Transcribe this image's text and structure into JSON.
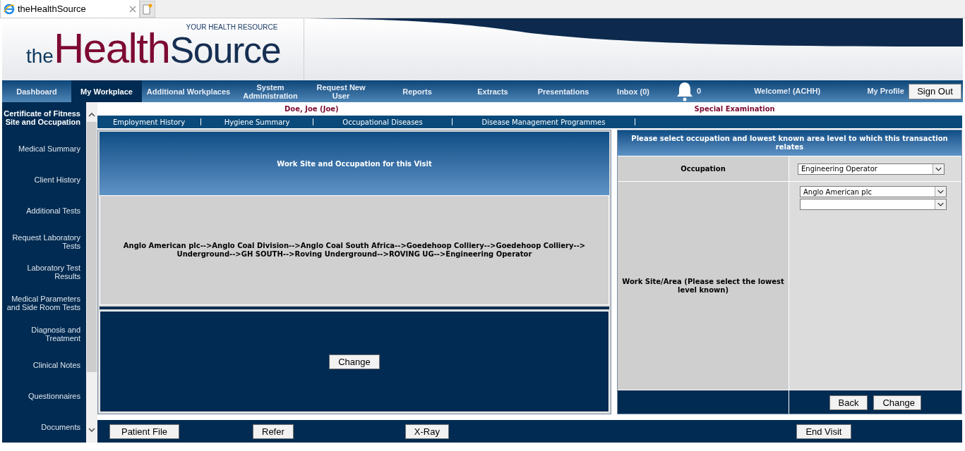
{
  "browser_tab": {
    "title": "theHealthSource"
  },
  "logo": {
    "the": "the",
    "health": "Health",
    "source": "Source",
    "tagline": "YOUR HEALTH RESOURCE"
  },
  "nav": {
    "items": [
      {
        "label": "Dashboard",
        "selected": false
      },
      {
        "label": "My Workplace",
        "selected": true
      },
      {
        "label": "Additional Workplaces",
        "selected": false
      },
      {
        "label": "System Administration",
        "selected": false
      },
      {
        "label": "Request New User",
        "selected": false
      },
      {
        "label": "Reports",
        "selected": false
      },
      {
        "label": "Extracts",
        "selected": false
      },
      {
        "label": "Presentations",
        "selected": false
      },
      {
        "label": "Inbox (0)",
        "selected": false
      }
    ],
    "notification_count": "0",
    "welcome": "Welcome! (ACHH)",
    "profile": "My Profile",
    "sign_out": "Sign Out"
  },
  "sidebar": {
    "items": [
      {
        "label": "Certificate of Fitness Site and Occupation",
        "selected": true
      },
      {
        "label": "Medical Summary",
        "selected": false
      },
      {
        "label": "Client History",
        "selected": false
      },
      {
        "label": "Additional Tests",
        "selected": false
      },
      {
        "label": "Request Laboratory Tests",
        "selected": false
      },
      {
        "label": "Laboratory Test Results",
        "selected": false
      },
      {
        "label": "Medical Parameters and Side Room Tests",
        "selected": false
      },
      {
        "label": "Diagnosis and Treatment",
        "selected": false
      },
      {
        "label": "Clinical Notes",
        "selected": false
      },
      {
        "label": "Questionnaires",
        "selected": false
      },
      {
        "label": "Documents",
        "selected": false
      }
    ]
  },
  "patient": {
    "name": "Doe, Joe (Joe)",
    "examination": "Special Examination"
  },
  "subtabs": [
    "Employment History",
    "Hygiene Summary",
    "Occupational Diseases",
    "Disease Management Programmes"
  ],
  "work_site": {
    "title": "Work Site and Occupation for this Visit",
    "path": "Anglo American plc-->Anglo Coal Division-->Anglo Coal South Africa-->Goedehoop Colliery-->Goedehoop Colliery-->Underground-->GH SOUTH-->Roving Underground-->ROVING UG-->Engineering Operator",
    "change_button": "Change"
  },
  "selection": {
    "title": "Please select occupation and lowest known area level to which this transaction relates",
    "occupation_label": "Occupation",
    "occupation_value": "Engineering Operator",
    "area_label": "Work Site/Area (Please select the lowest level known)",
    "area_value": "Anglo American plc",
    "back_button": "Back",
    "change_button": "Change"
  },
  "footer_buttons": [
    "Patient File",
    "Refer",
    "X-Ray",
    "End Visit"
  ]
}
